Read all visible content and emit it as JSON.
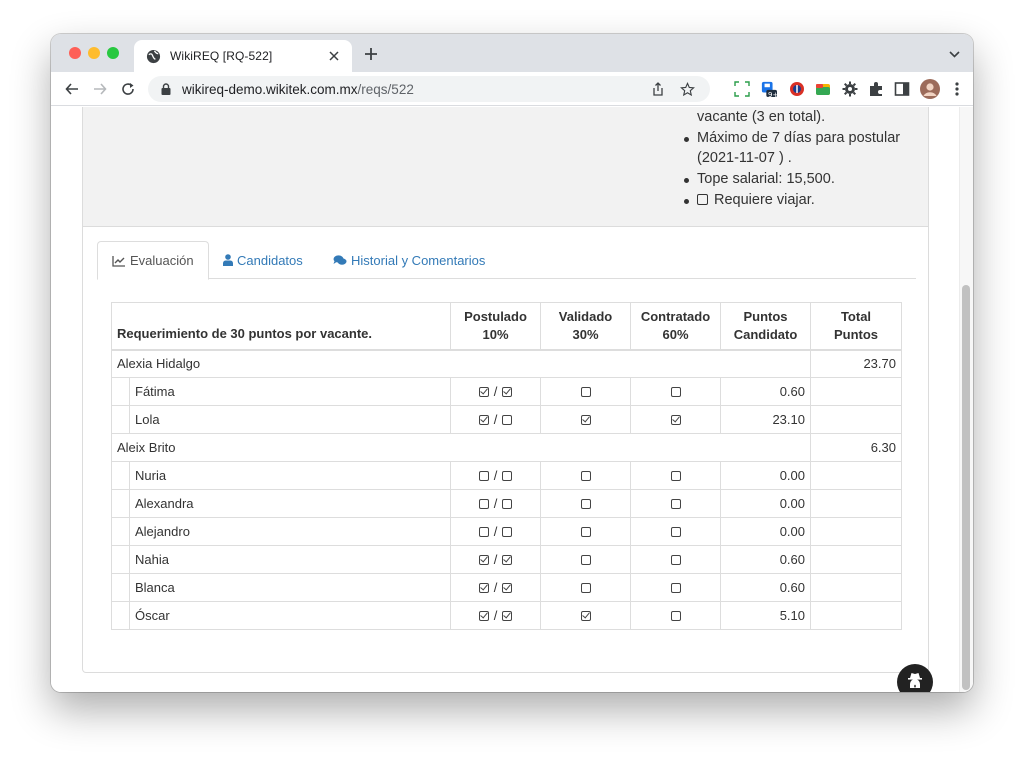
{
  "browser": {
    "tab_title": "WikiREQ [RQ-522]",
    "url_host": "wikireq-demo.wikitek.com.mx",
    "url_path": "/reqs/522",
    "extension_badge": "9+"
  },
  "details": {
    "lines": [
      {
        "text": "vacante (3 en total).",
        "bullet": false
      },
      {
        "text": "Máximo de 7 días para postular",
        "bullet": true
      },
      {
        "text": "(2021-11-07 ) .",
        "bullet": false
      },
      {
        "text": "Tope salarial: 15,500.",
        "bullet": true
      },
      {
        "text": "Requiere viajar.",
        "bullet": true,
        "checkbox": true
      }
    ]
  },
  "tabs": [
    {
      "label": "Evaluación",
      "icon": "chart-line-icon",
      "active": true
    },
    {
      "label": "Candidatos",
      "icon": "user-icon",
      "active": false
    },
    {
      "label": "Historial y Comentarios",
      "icon": "comments-icon",
      "active": false
    }
  ],
  "table": {
    "headers": {
      "requirement": "Requerimiento de 30 puntos por vacante.",
      "postulado": [
        "Postulado",
        "10%"
      ],
      "validado": [
        "Validado",
        "30%"
      ],
      "contratado": [
        "Contratado",
        "60%"
      ],
      "puntos": [
        "Puntos",
        "Candidato"
      ],
      "total": [
        "Total",
        "Puntos"
      ]
    },
    "groups": [
      {
        "recruiter": "Alexia Hidalgo",
        "total": "23.70",
        "candidates": [
          {
            "name": "Fátima",
            "postulado": [
              true,
              true
            ],
            "validado": false,
            "contratado": false,
            "puntos": "0.60"
          },
          {
            "name": "Lola",
            "postulado": [
              true,
              false
            ],
            "validado": true,
            "contratado": true,
            "puntos": "23.10"
          }
        ]
      },
      {
        "recruiter": "Aleix Brito",
        "total": "6.30",
        "candidates": [
          {
            "name": "Nuria",
            "postulado": [
              false,
              false
            ],
            "validado": false,
            "contratado": false,
            "puntos": "0.00"
          },
          {
            "name": "Alexandra",
            "postulado": [
              false,
              false
            ],
            "validado": false,
            "contratado": false,
            "puntos": "0.00"
          },
          {
            "name": "Alejandro",
            "postulado": [
              false,
              false
            ],
            "validado": false,
            "contratado": false,
            "puntos": "0.00"
          },
          {
            "name": "Nahia",
            "postulado": [
              true,
              true
            ],
            "validado": false,
            "contratado": false,
            "puntos": "0.60"
          },
          {
            "name": "Blanca",
            "postulado": [
              true,
              true
            ],
            "validado": false,
            "contratado": false,
            "puntos": "0.60"
          },
          {
            "name": "Óscar",
            "postulado": [
              true,
              true
            ],
            "validado": true,
            "contratado": false,
            "puntos": "5.10"
          }
        ]
      }
    ]
  },
  "colors": {
    "link": "#337ab7",
    "panel_gray": "#f2f2f2",
    "fab": "#222222"
  }
}
